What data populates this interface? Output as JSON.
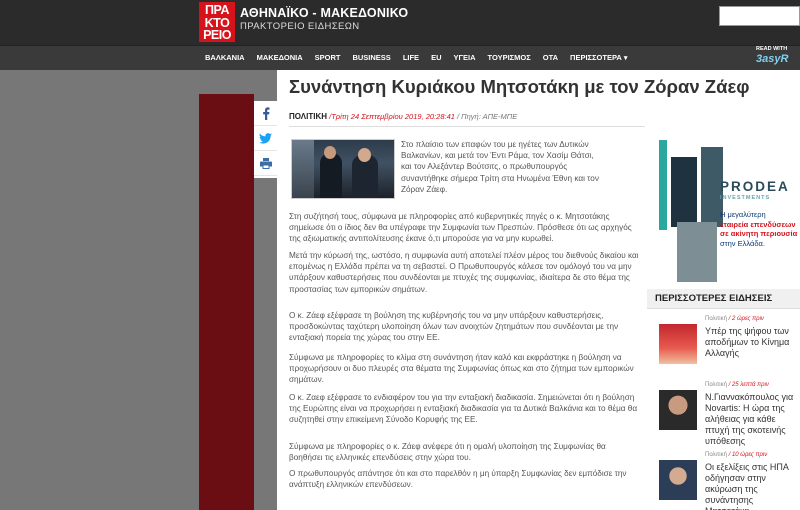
{
  "header": {
    "logo_text": "ΠΡΑ ΚΤΟ ΡΕΙΟ",
    "brand_name": "ΑΘΗΝΑΪΚΟ - ΜΑΚΕΔΟΝΙΚΟ",
    "brand_sub": "ΠΡΑΚΤΟΡΕΙΟ ΕΙΔΗΣΕΩΝ",
    "search_placeholder": ""
  },
  "nav": {
    "items": [
      "ΒΑΛΚΑΝΙΑ",
      "ΜΑΚΕΔΟΝΙΑ",
      "SPORT",
      "BUSINESS",
      "LIFE",
      "EU",
      "ΥΓΕΙΑ",
      "ΤΟΥΡΙΣΜΟΣ",
      "ΟΤΑ",
      "ΠΕΡΙΣΣΟΤΕΡΑ"
    ],
    "more_caret": "▾",
    "read_with": "READ WITH",
    "read_with_logo": "3asyR"
  },
  "article": {
    "title": "Συνάντηση Κυριάκου Μητσοτάκη με τον Ζόραν Ζάεφ",
    "category": "ΠΟΛΙΤΙΚΗ",
    "date": "/Τρίτη 24 Σεπτεμβρίου 2019, 20:28:41",
    "source": "/ Πηγή: ΑΠΕ-ΜΠΕ",
    "intro_lines": [
      "Στο πλαίσιο των επαφών του με ηγέτες των Δυτικών",
      "Βαλκανίων, και μετά τον Έντι Ράμα, τον Χασίμ Θάτσι,",
      "και τον Αλεξάντερ Βούτσιτς, ο πρωθυπουργός",
      "συναντήθηκε σήμερα Τρίτη στα Ηνωμένα Έθνη και τον",
      "Ζόραν Ζάεφ."
    ],
    "paragraphs": [
      "Στη συζήτησή τους, σύμφωνα με πληροφορίες από κυβερνητικές πηγές ο κ. Μητσοτάκης σημείωσε ότι ο ίδιος δεν θα υπέγραφε την Συμφωνία των Πρεσπών. Πρόσθεσε ότι ως αρχηγός της αξιωματικής αντιπολίτευσης έκανε ό,τι μπορούσε για να μην κυρωθεί.",
      "Μετά την κύρωσή της, ωστόσο, η συμφωνία αυτή αποτελεί πλέον μέρος του διεθνούς δικαίου και επομένως η Ελλάδα πρέπει να τη σεβαστεί. Ο Πρωθυπουργός κάλεσε τον ομόλογό του να μην υπάρξουν καθυστερήσεις που συνδέονται με πτυχές της συμφωνίας, ιδιαίτερα δε στο θέμα της προστασίας των εμπορικών σημάτων.",
      "Ο κ. Ζάεφ εξέφρασε τη βούληση της κυβέρνησής του να μην υπάρξουν καθυστερήσεις, προσδοκώντας ταχύτερη υλοποίηση όλων των ανοιχτών ζητημάτων που συνδέονται με την ενταξιακή πορεία της χώρας του στην ΕΕ.",
      "Σύμφωνα με πληροφορίες το κλίμα στη συνάντηση ήταν καλό και εκφράστηκε η βούληση να προχωρήσουν οι δυο πλευρές στα θέματα της Συμφωνίας όπως και στο ζήτημα των εμπορικών σημάτων.",
      "Ο κ. Ζαεφ εξέφρασε το ενδιαφέρον του για την ενταξιακή διαδικασία. Σημειώνεται ότι η βούληση της Ευρώπης είναι να προχωρήσει η ενταξιακή διαδικασία για τα Δυτικά Βαλκάνια και το θέμα θα συζητηθεί στην επικείμενη Σύνοδο Κορυφής της ΕΕ.",
      "Σύμφωνα με πληροφορίες ο κ. Ζάεφ ανέφερε ότι η ομαλή υλοποίηση της Συμφωνίας θα βοηθήσει τις ελληνικές επενδύσεις στην χώρα του.",
      "Ο πρωθυπουργός απάντησε ότι και στο παρελθόν η μη ύπαρξη Συμφωνίας δεν εμπόδισε την ανάπτυξη ελληνικών επενδύσεων."
    ]
  },
  "sidebar": {
    "ad": {
      "brand": "PRODEA",
      "brand_sub": "INVESTMENTS",
      "line1": "Η μεγαλύτερη",
      "line2": "εταιρεία επενδύσεων",
      "line3": "σε ακίνητη περιουσία",
      "line4": "στην Ελλάδα."
    },
    "popular_title": "ΠΕΡΙΣΣΟΤΕΡΕΣ ΕΙΔΗΣΕΙΣ",
    "news": [
      {
        "category": "Πολιτική",
        "time": "/ 2 ώρες πριν",
        "title": "Υπέρ της ψήφου των αποδήμων το Κίνημα Αλλαγής"
      },
      {
        "category": "Πολιτική",
        "time": "/ 25 λεπτά πριν",
        "title": "Ν.Γιαννακόπουλος για Novartis: Η ώρα της αλήθειας για κάθε πτυχή της σκοτεινής υπόθεσης"
      },
      {
        "category": "Πολιτική",
        "time": "/ 10 ώρες πριν",
        "title": "Οι εξελίξεις στις ΗΠΑ οδήγησαν στην ακύρωση της συνάντησης Μητσοτάκη-"
      }
    ]
  },
  "colors": {
    "accent": "#d6121b",
    "header_bg": "#2b2b2b",
    "side_bar": "#6a0e14"
  }
}
